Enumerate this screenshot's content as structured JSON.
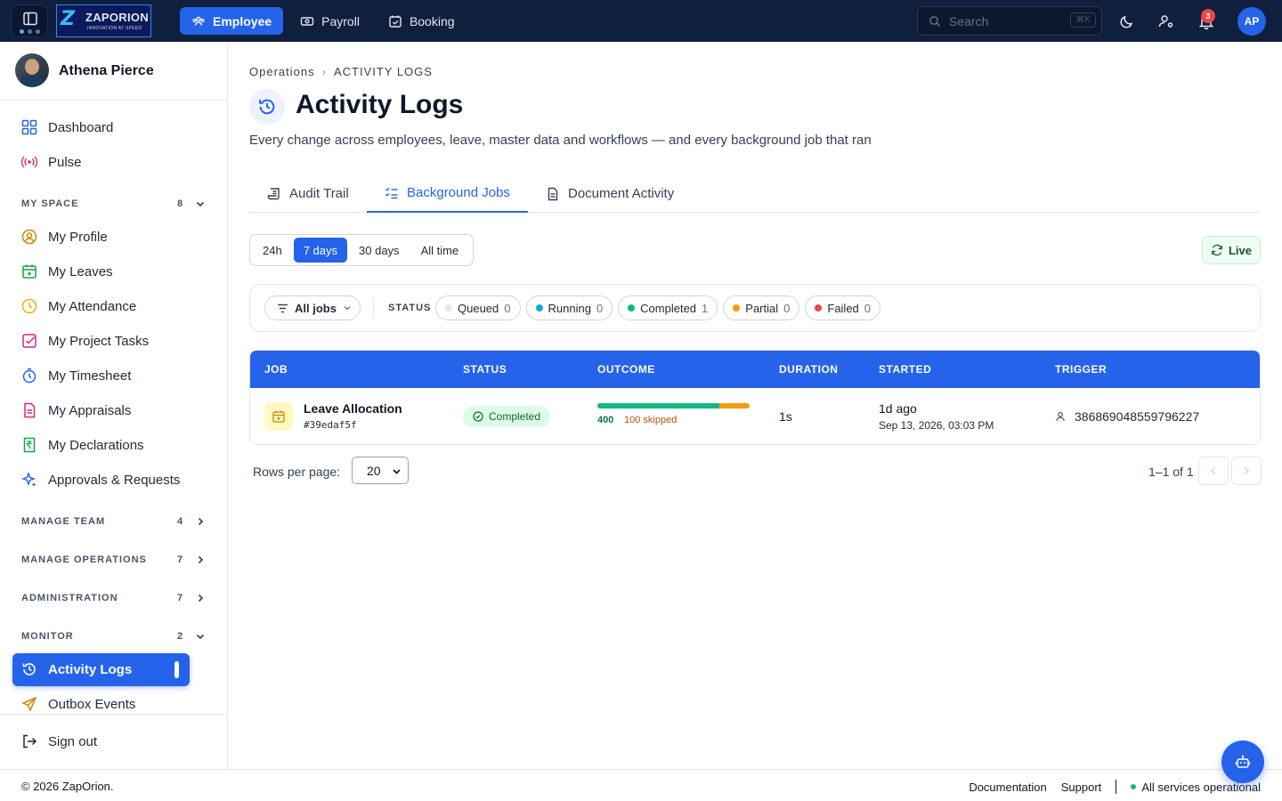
{
  "topbar": {
    "logo": {
      "brand": "ZAPORION",
      "tagline": "INNOVATION AT SPEED"
    },
    "nav": [
      {
        "label": "Employee",
        "icon": "users-icon",
        "active": true
      },
      {
        "label": "Payroll",
        "icon": "cash-icon",
        "active": false
      },
      {
        "label": "Booking",
        "icon": "calendar-check-icon",
        "active": false
      }
    ],
    "search": {
      "placeholder": "Search",
      "shortcut": "⌘K"
    },
    "notifications_count": "3",
    "avatar_initials": "AP"
  },
  "sidebar": {
    "user_name": "Athena Pierce",
    "top_items": [
      {
        "label": "Dashboard",
        "icon": "grid-icon"
      },
      {
        "label": "Pulse",
        "icon": "broadcast-icon"
      }
    ],
    "sections": {
      "my_space": {
        "label": "MY SPACE",
        "count": "8",
        "expanded": true
      },
      "manage_team": {
        "label": "MANAGE TEAM",
        "count": "4",
        "expanded": false
      },
      "manage_operations": {
        "label": "MANAGE OPERATIONS",
        "count": "7",
        "expanded": false
      },
      "administration": {
        "label": "ADMINISTRATION",
        "count": "7",
        "expanded": false
      },
      "monitor": {
        "label": "MONITOR",
        "count": "2",
        "expanded": true
      }
    },
    "my_space_items": [
      {
        "label": "My Profile",
        "icon": "user-circle-icon"
      },
      {
        "label": "My Leaves",
        "icon": "calendar-plus-icon"
      },
      {
        "label": "My Attendance",
        "icon": "clock-icon"
      },
      {
        "label": "My Project Tasks",
        "icon": "checkbox-icon"
      },
      {
        "label": "My Timesheet",
        "icon": "stopwatch-icon"
      },
      {
        "label": "My Appraisals",
        "icon": "document-icon"
      },
      {
        "label": "My Declarations",
        "icon": "rupee-document-icon"
      },
      {
        "label": "Approvals & Requests",
        "icon": "sparkle-icon"
      }
    ],
    "monitor_items": [
      {
        "label": "Activity Logs",
        "icon": "history-icon",
        "active": true
      },
      {
        "label": "Outbox Events",
        "icon": "send-icon",
        "active": false
      }
    ],
    "sign_out": "Sign out"
  },
  "main": {
    "breadcrumb": [
      "Operations",
      "ACTIVITY LOGS"
    ],
    "title": "Activity Logs",
    "subtitle": "Every change across employees, leave, master data and workflows — and every background job that ran",
    "tabs": [
      {
        "label": "Audit Trail",
        "icon": "scroll-icon",
        "active": false
      },
      {
        "label": "Background Jobs",
        "icon": "list-check-icon",
        "active": true
      },
      {
        "label": "Document Activity",
        "icon": "file-text-icon",
        "active": false
      }
    ],
    "time_ranges": [
      {
        "label": "24h",
        "active": false
      },
      {
        "label": "7 days",
        "active": true
      },
      {
        "label": "30 days",
        "active": false
      },
      {
        "label": "All time",
        "active": false
      }
    ],
    "live_label": "Live",
    "filters": {
      "job_select": "All jobs",
      "status_label": "STATUS",
      "chips": [
        {
          "label": "Queued",
          "count": "0",
          "color": "#e5e7eb"
        },
        {
          "label": "Running",
          "count": "0",
          "color": "#0ea5e9"
        },
        {
          "label": "Completed",
          "count": "1",
          "color": "#10b981"
        },
        {
          "label": "Partial",
          "count": "0",
          "color": "#f59e0b"
        },
        {
          "label": "Failed",
          "count": "0",
          "color": "#ef4444"
        }
      ]
    },
    "table": {
      "headers": [
        "JOB",
        "STATUS",
        "OUTCOME",
        "DURATION",
        "STARTED",
        "TRIGGER"
      ],
      "rows": [
        {
          "job_name": "Leave Allocation",
          "job_id": "#39edaf5f",
          "status": "Completed",
          "outcome_ok": "400",
          "outcome_skipped": "100 skipped",
          "outcome_success_fraction": 0.8,
          "duration": "1s",
          "started_relative": "1d ago",
          "started_absolute": "Sep 13, 2026, 03:03 PM",
          "trigger": "386869048559796227"
        }
      ]
    },
    "pagination": {
      "rows_per_page_label": "Rows per page:",
      "rows_per_page": "20",
      "range": "1–1 of 1"
    }
  },
  "footer": {
    "copyright": "© 2026 ZapOrion.",
    "links": [
      "Documentation",
      "Support"
    ],
    "status": "All services operational"
  },
  "colors": {
    "primary": "#2563eb",
    "topbar": "#0f1f3d",
    "success": "#10b981",
    "warning": "#f59e0b"
  }
}
